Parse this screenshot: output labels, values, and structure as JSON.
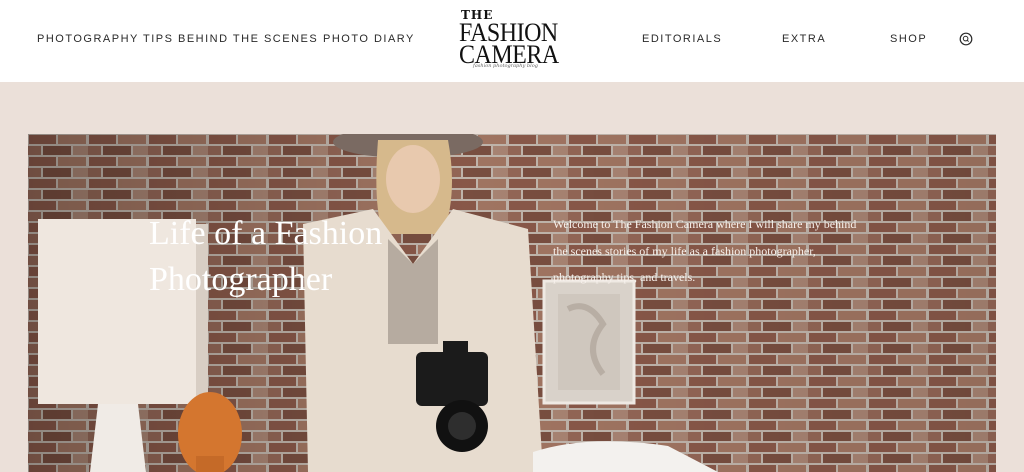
{
  "nav": {
    "left": [
      {
        "label": "PHOTOGRAPHY TIPS"
      },
      {
        "label": "BEHIND THE SCENES"
      },
      {
        "label": "PHOTO DIARY"
      }
    ],
    "right": [
      {
        "label": "EDITORIALS"
      },
      {
        "label": "EXTRA"
      },
      {
        "label": "SHOP"
      }
    ],
    "search_icon": "search-icon"
  },
  "logo": {
    "line1": "THE",
    "line2": "FASHION",
    "line3": "CAMERA",
    "tagline": "fashion photography blog"
  },
  "hero": {
    "title": "Life of a Fashion Photographer",
    "text": "Welcome to The Fashion Camera where I will share my behind the scenes stories of my life as a fashion photographer, photography tips, and travels."
  },
  "colors": {
    "band": "#ebe0d9",
    "header": "#ffffff",
    "nav_text": "#2a2a2a",
    "brick": "#8b5a4a",
    "mortar": "#c9bdb3"
  }
}
